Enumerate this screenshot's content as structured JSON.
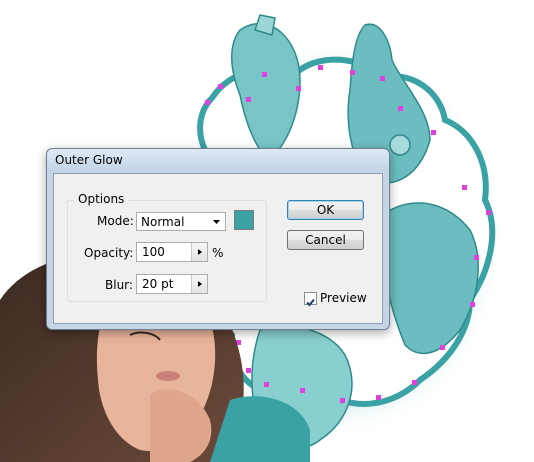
{
  "dialog": {
    "title": "Outer Glow",
    "group_label": "Options",
    "mode": {
      "label": "Mode:",
      "value": "Normal"
    },
    "glow_color": "#3aa2a4",
    "opacity": {
      "label": "Opacity:",
      "value": "100",
      "unit": "%"
    },
    "blur": {
      "label": "Blur:",
      "value": "20 pt"
    },
    "ok_label": "OK",
    "cancel_label": "Cancel",
    "preview_label": "Preview",
    "preview_checked": true
  },
  "artwork": {
    "teal": "#3aa2a4",
    "anchor_color": "#e040e0"
  }
}
